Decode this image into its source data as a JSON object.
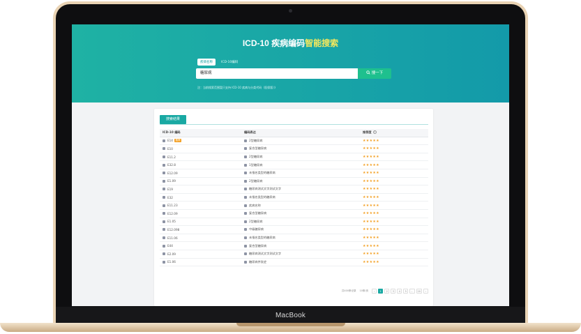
{
  "colors": {
    "brand": "#19a9a3",
    "highlight": "#f6e85c",
    "search_button": "#1ec08e",
    "star": "#f3a024"
  },
  "device": {
    "label": "MacBook"
  },
  "hero": {
    "title_prefix": "ICD-10 疾病编码",
    "title_highlight": "智能搜索",
    "tabs": [
      {
        "label": "疾病名称",
        "active": true
      },
      {
        "label": "ICD-10编码",
        "active": false
      }
    ],
    "search_value": "糖尿病",
    "search_button_label": "搜一下",
    "note": "注：当前搜索范围暂只支持 ICD-10 疾病与分类代码（医保版）》"
  },
  "results": {
    "tab_label": "搜索结果",
    "columns": {
      "code": "ICD-10 编码",
      "expr": "编码表达",
      "rating": "推荐度"
    },
    "rows": [
      {
        "code": "E14",
        "badge": "推荐",
        "expr": "2型糖尿病",
        "stars": "★★★★★"
      },
      {
        "code": "E10",
        "badge": "",
        "expr": "复合型糖尿病",
        "stars": "★★★★★"
      },
      {
        "code": "E11.2",
        "badge": "",
        "expr": "2型糖尿病",
        "stars": "★★★★★"
      },
      {
        "code": "E32.8",
        "badge": "",
        "expr": "1型糖尿病",
        "stars": "★★★★★"
      },
      {
        "code": "E12.09",
        "badge": "",
        "expr": "未指名类型的糖尿病",
        "stars": "★★★★★"
      },
      {
        "code": "E1.09",
        "badge": "",
        "expr": "2型糖尿病",
        "stars": "★★★★★"
      },
      {
        "code": "E19",
        "badge": "",
        "expr": "糖尿病测试文字测试文字",
        "stars": "★★★★★"
      },
      {
        "code": "E32",
        "badge": "",
        "expr": "未指名类型的糖尿病",
        "stars": "★★★★★"
      },
      {
        "code": "E11.23",
        "badge": "",
        "expr": "疾病名称",
        "stars": "★★★★★"
      },
      {
        "code": "E12.09",
        "badge": "",
        "expr": "复合型糖尿病",
        "stars": "★★★★★"
      },
      {
        "code": "E1.05",
        "badge": "",
        "expr": "2型糖尿病",
        "stars": "★★★★★"
      },
      {
        "code": "E12.098",
        "badge": "",
        "expr": "中级糖尿病",
        "stars": "★★★★★"
      },
      {
        "code": "E11.06",
        "badge": "",
        "expr": "未指名类型的糖尿病",
        "stars": "★★★★★"
      },
      {
        "code": "E44",
        "badge": "",
        "expr": "复合型糖尿病",
        "stars": "★★★★★"
      },
      {
        "code": "E2.09",
        "badge": "",
        "expr": "糖尿病测试文字测试文字",
        "stars": "★★★★★"
      },
      {
        "code": "E1.06",
        "badge": "",
        "expr": "糖尿病并发症",
        "stars": "★★★★★"
      }
    ],
    "pagination": {
      "total_text": "共400条记录",
      "page_size_text": "10条/页",
      "prev": "‹",
      "pages": [
        "1",
        "2",
        "3",
        "4",
        "5",
        "...",
        "20"
      ],
      "next": "›",
      "current": "1"
    }
  }
}
